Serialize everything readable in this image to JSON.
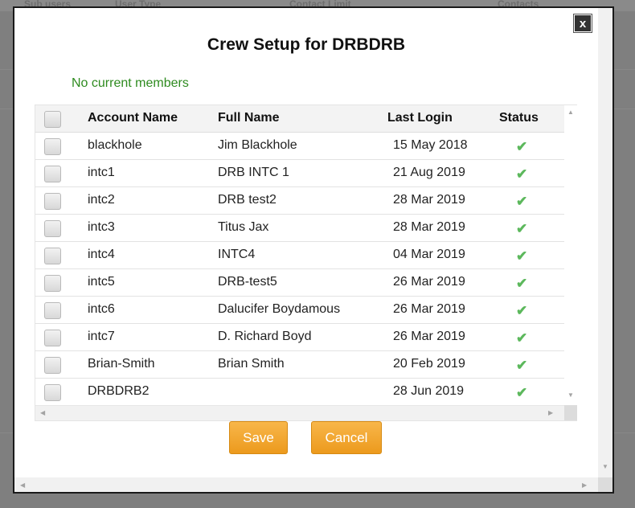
{
  "background": {
    "headers": [
      "Sub users",
      "User Type",
      "Contact Limit",
      "Contacts"
    ]
  },
  "modal": {
    "close_label": "x",
    "title": "Crew Setup for DRBDRB",
    "no_members_text": "No current members",
    "columns": {
      "account": "Account Name",
      "full": "Full Name",
      "login": "Last Login",
      "status": "Status"
    },
    "rows": [
      {
        "account": "blackhole",
        "full": "Jim Blackhole",
        "login": "15 May 2018",
        "status": "active"
      },
      {
        "account": "intc1",
        "full": "DRB INTC 1",
        "login": "21 Aug 2019",
        "status": "active"
      },
      {
        "account": "intc2",
        "full": "DRB test2",
        "login": "28 Mar 2019",
        "status": "active"
      },
      {
        "account": "intc3",
        "full": "Titus Jax",
        "login": "28 Mar 2019",
        "status": "active"
      },
      {
        "account": "intc4",
        "full": "INTC4",
        "login": "04 Mar 2019",
        "status": "active"
      },
      {
        "account": "intc5",
        "full": "DRB-test5",
        "login": "26 Mar 2019",
        "status": "active"
      },
      {
        "account": "intc6",
        "full": "Dalucifer Boydamous",
        "login": "26 Mar 2019",
        "status": "active"
      },
      {
        "account": "intc7",
        "full": "D. Richard Boyd",
        "login": "26 Mar 2019",
        "status": "active"
      },
      {
        "account": "Brian-Smith",
        "full": "Brian Smith",
        "login": "20 Feb 2019",
        "status": "active"
      },
      {
        "account": "DRBDRB2",
        "full": "",
        "login": "28 Jun 2019",
        "status": "active"
      }
    ],
    "save_label": "Save",
    "cancel_label": "Cancel"
  },
  "icons": {
    "status_active": "check-icon",
    "close": "close-icon"
  },
  "colors": {
    "no_members_text": "#2e8b1f",
    "button_orange": "#f0a030",
    "check_green": "#5cb85c",
    "close_button_bg": "#333333"
  }
}
